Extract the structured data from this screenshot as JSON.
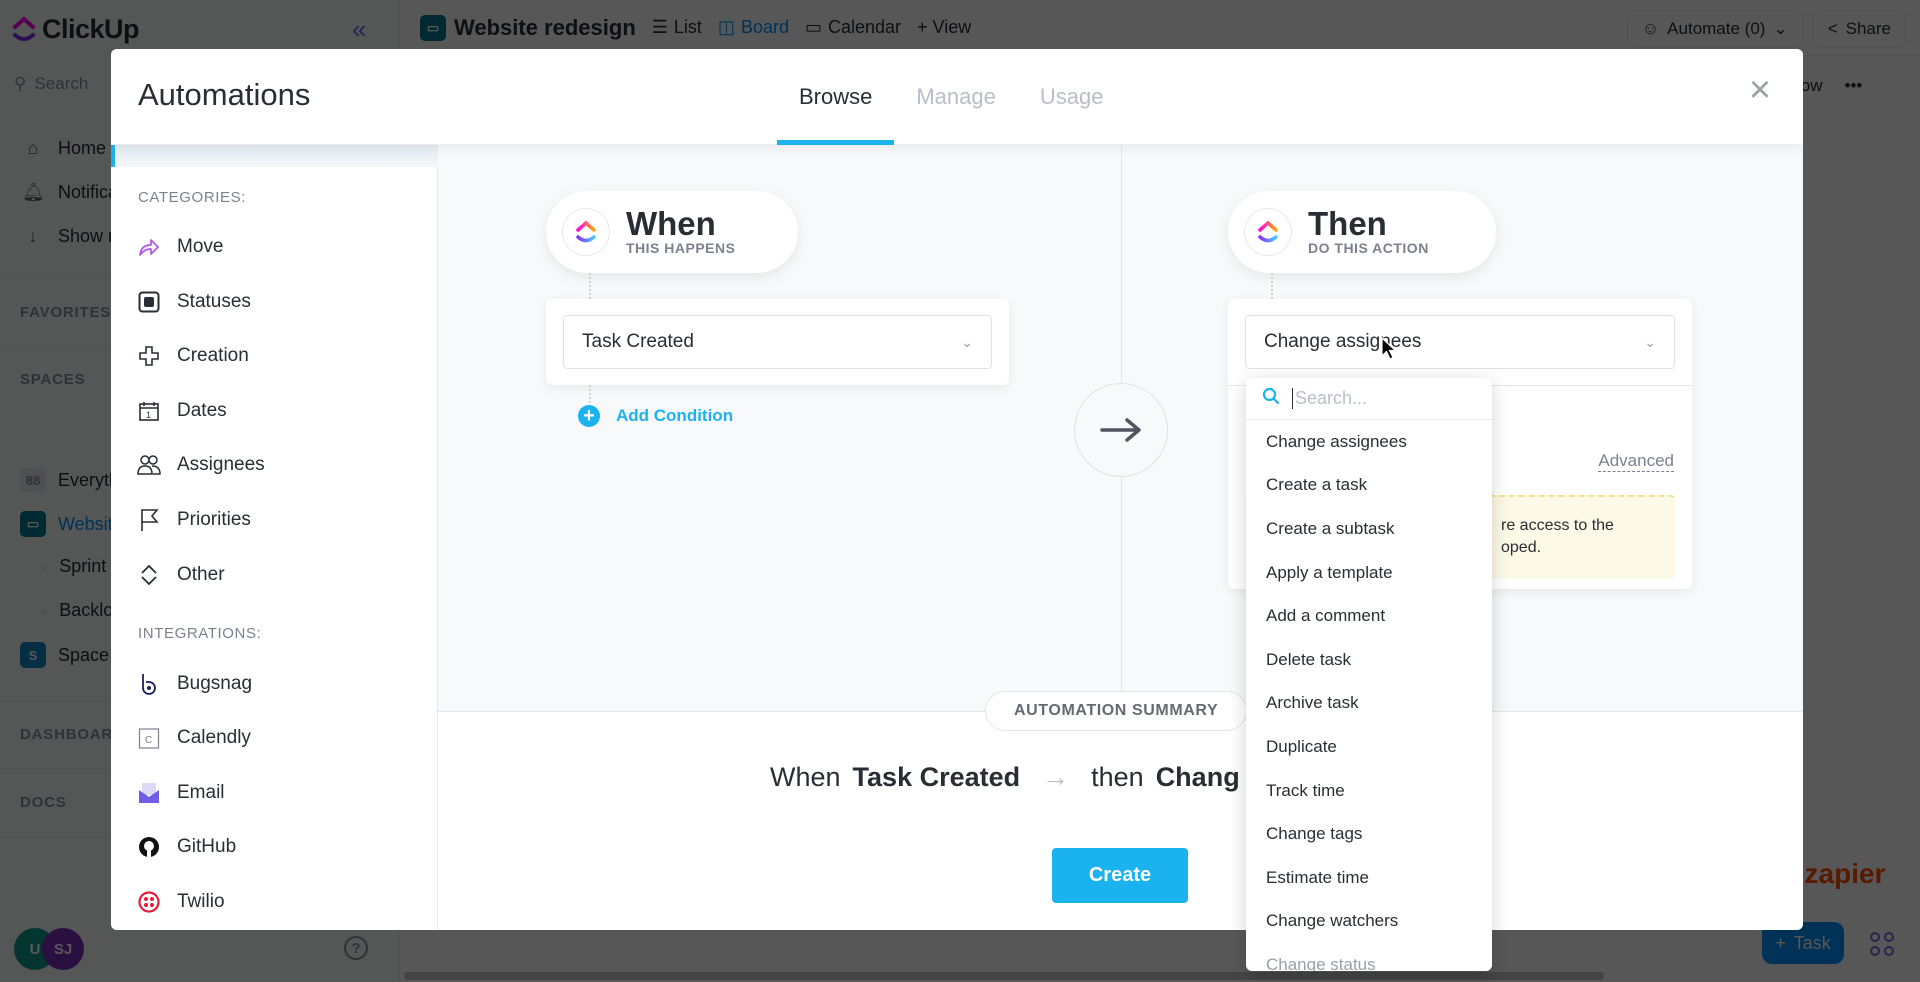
{
  "app": {
    "brand": "ClickUp",
    "search_placeholder": "Search",
    "nav": [
      {
        "label": "Home",
        "icon": "home-icon"
      },
      {
        "label": "Notifications",
        "icon": "bell-icon"
      },
      {
        "label": "Show more",
        "icon": "arrow-down-icon"
      }
    ],
    "sections": {
      "favorites": "FAVORITES",
      "spaces": "SPACES",
      "dashboards": "DASHBOARDS",
      "docs": "DOCS"
    },
    "spaces": [
      {
        "label": "Everything",
        "icon": "grid-icon"
      },
      {
        "label": "Website redesign",
        "icon": "monitor-icon"
      },
      {
        "label": "Sprint",
        "icon": "circle-icon",
        "sub": true
      },
      {
        "label": "Backlog",
        "icon": "circle-icon",
        "sub": true
      },
      {
        "label": "Space",
        "icon": "space-s-icon",
        "letter": "S"
      }
    ],
    "avatars": [
      "U",
      "SJ"
    ],
    "project_title": "Website redesign",
    "views": [
      "List",
      "Board",
      "Calendar"
    ],
    "add_view": "+ View",
    "automate": "Automate (0)",
    "share": "Share",
    "show": "Show",
    "zapier": "zapier",
    "add_task": "Task"
  },
  "modal": {
    "title": "Automations",
    "tabs": [
      {
        "label": "Browse",
        "active": true
      },
      {
        "label": "Manage",
        "active": false
      },
      {
        "label": "Usage",
        "active": false
      }
    ],
    "categories_heading": "CATEGORIES:",
    "categories": [
      {
        "label": "Move",
        "icon": "move-arrow-icon"
      },
      {
        "label": "Statuses",
        "icon": "status-square-icon"
      },
      {
        "label": "Creation",
        "icon": "plus-outline-icon"
      },
      {
        "label": "Dates",
        "icon": "calendar-icon"
      },
      {
        "label": "Assignees",
        "icon": "people-icon"
      },
      {
        "label": "Priorities",
        "icon": "flag-icon"
      },
      {
        "label": "Other",
        "icon": "other-chevrons-icon"
      }
    ],
    "integrations_heading": "INTEGRATIONS:",
    "integrations": [
      {
        "label": "Bugsnag",
        "icon": "bugsnag-icon"
      },
      {
        "label": "Calendly",
        "icon": "calendly-icon"
      },
      {
        "label": "Email",
        "icon": "email-icon"
      },
      {
        "label": "GitHub",
        "icon": "github-icon"
      },
      {
        "label": "Twilio",
        "icon": "twilio-icon"
      }
    ],
    "when": {
      "title": "When",
      "subtitle": "THIS HAPPENS",
      "trigger": "Task Created",
      "add_condition": "Add Condition"
    },
    "then": {
      "title": "Then",
      "subtitle": "DO THIS ACTION",
      "action": "Change assignees",
      "advanced": "Advanced",
      "warning_line1": "re access to the",
      "warning_line2": "oped."
    },
    "summary": {
      "label": "AUTOMATION SUMMARY",
      "when": "When",
      "trigger": "Task Created",
      "then": "then",
      "action": "Chang"
    },
    "create": "Create",
    "dropdown": {
      "search_placeholder": "Search...",
      "items": [
        "Change assignees",
        "Create a task",
        "Create a subtask",
        "Apply a template",
        "Add a comment",
        "Delete task",
        "Archive task",
        "Duplicate",
        "Track time",
        "Change tags",
        "Estimate time",
        "Change watchers",
        "Change status"
      ]
    }
  }
}
